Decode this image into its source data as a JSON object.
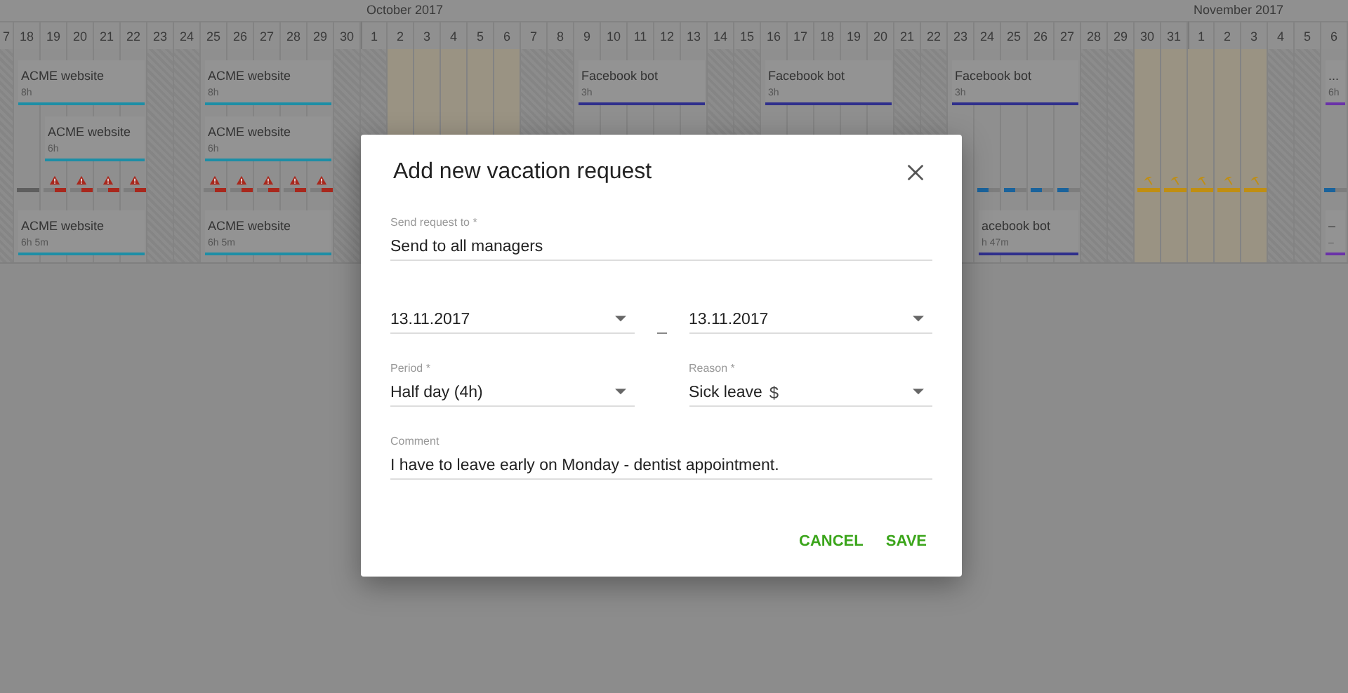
{
  "calendar": {
    "days": [
      {
        "label": "7",
        "kind": "weekend"
      },
      {
        "label": "18",
        "kind": "weekday",
        "marker": {
          "kind": "idle"
        },
        "tasks": [
          {
            "kind": "top",
            "title": "ACME website",
            "hours": "8h",
            "color": "#1d8ea6"
          },
          {
            "kind": "bottom",
            "title": "ACME website",
            "hours": "6h 5m",
            "color": "#1d8ea6"
          }
        ]
      },
      {
        "label": "19",
        "kind": "weekday",
        "marker": {
          "kind": "warning"
        },
        "tasks": [
          {
            "kind": "middle",
            "title": "ACME website",
            "hours": "6h",
            "color": "#1d8ea6"
          }
        ]
      },
      {
        "label": "20",
        "kind": "weekday",
        "marker": {
          "kind": "warning"
        }
      },
      {
        "label": "21",
        "kind": "weekday",
        "marker": {
          "kind": "warning"
        }
      },
      {
        "label": "22",
        "kind": "weekday",
        "marker": {
          "kind": "warning"
        }
      },
      {
        "label": "23",
        "kind": "weekend"
      },
      {
        "label": "24",
        "kind": "weekend"
      },
      {
        "label": "25",
        "kind": "weekday",
        "marker": {
          "kind": "warning"
        },
        "tasks": [
          {
            "kind": "top",
            "title": "ACME website",
            "hours": "8h",
            "color": "#1d8ea6"
          },
          {
            "kind": "middle",
            "title": "ACME website",
            "hours": "6h",
            "color": "#1d8ea6"
          },
          {
            "kind": "bottom",
            "title": "ACME website",
            "hours": "6h 5m",
            "color": "#1d8ea6"
          }
        ]
      },
      {
        "label": "26",
        "kind": "weekday",
        "marker": {
          "kind": "warning"
        }
      },
      {
        "label": "27",
        "kind": "weekday",
        "marker": {
          "kind": "warning"
        }
      },
      {
        "label": "28",
        "kind": "weekday",
        "marker": {
          "kind": "warning"
        }
      },
      {
        "label": "29",
        "kind": "weekday",
        "marker": {
          "kind": "warning"
        }
      },
      {
        "label": "30",
        "kind": "weekend"
      },
      {
        "label": "1",
        "kind": "weekend",
        "month": "October 2017"
      },
      {
        "label": "2",
        "kind": "vacation"
      },
      {
        "label": "3",
        "kind": "vacation"
      },
      {
        "label": "4",
        "kind": "vacation"
      },
      {
        "label": "5",
        "kind": "vacation"
      },
      {
        "label": "6",
        "kind": "vacation"
      },
      {
        "label": "7",
        "kind": "weekend"
      },
      {
        "label": "8",
        "kind": "weekend"
      },
      {
        "label": "9",
        "kind": "weekday",
        "tasks": [
          {
            "kind": "top",
            "title": "Facebook bot",
            "hours": "3h",
            "color": "#2f2f8c"
          }
        ]
      },
      {
        "label": "10",
        "kind": "weekday"
      },
      {
        "label": "11",
        "kind": "weekday"
      },
      {
        "label": "12",
        "kind": "weekday"
      },
      {
        "label": "13",
        "kind": "weekday"
      },
      {
        "label": "14",
        "kind": "weekend"
      },
      {
        "label": "15",
        "kind": "weekend"
      },
      {
        "label": "16",
        "kind": "weekday",
        "tasks": [
          {
            "kind": "top",
            "title": "Facebook bot",
            "hours": "3h",
            "color": "#2f2f8c"
          }
        ]
      },
      {
        "label": "17",
        "kind": "weekday"
      },
      {
        "label": "18",
        "kind": "weekday"
      },
      {
        "label": "19",
        "kind": "weekday"
      },
      {
        "label": "20",
        "kind": "weekday"
      },
      {
        "label": "21",
        "kind": "weekend"
      },
      {
        "label": "22",
        "kind": "weekend"
      },
      {
        "label": "23",
        "kind": "weekday",
        "tasks": [
          {
            "kind": "top",
            "title": "Facebook bot",
            "hours": "3h",
            "color": "#2f2f8c"
          }
        ]
      },
      {
        "label": "24",
        "kind": "weekday",
        "marker": {
          "kind": "planned"
        },
        "tasks": [
          {
            "kind": "bottom",
            "title": "acebook bot",
            "hours": "h 47m",
            "color": "#2f2f8c"
          }
        ]
      },
      {
        "label": "25",
        "kind": "weekday",
        "marker": {
          "kind": "planned"
        }
      },
      {
        "label": "26",
        "kind": "weekday",
        "marker": {
          "kind": "planned"
        }
      },
      {
        "label": "27",
        "kind": "weekday",
        "marker": {
          "kind": "planned"
        }
      },
      {
        "label": "28",
        "kind": "weekend"
      },
      {
        "label": "29",
        "kind": "weekend"
      },
      {
        "label": "30",
        "kind": "vacation",
        "marker": {
          "kind": "vacation"
        }
      },
      {
        "label": "31",
        "kind": "vacation",
        "marker": {
          "kind": "vacation"
        }
      },
      {
        "label": "1",
        "kind": "vacation",
        "marker": {
          "kind": "vacation"
        },
        "month": "November 2017"
      },
      {
        "label": "2",
        "kind": "vacation",
        "marker": {
          "kind": "vacation"
        }
      },
      {
        "label": "3",
        "kind": "vacation",
        "marker": {
          "kind": "vacation"
        }
      },
      {
        "label": "4",
        "kind": "weekend"
      },
      {
        "label": "5",
        "kind": "weekend"
      },
      {
        "label": "6",
        "kind": "weekday",
        "marker": {
          "kind": "planned"
        },
        "tasks": [
          {
            "kind": "top",
            "title": "...",
            "hours": "6h",
            "color": "#6a32a8"
          },
          {
            "kind": "bottom",
            "title": "–",
            "hours": "–",
            "color": "#6a32a8"
          }
        ]
      }
    ]
  },
  "dialog": {
    "title": "Add new vacation request",
    "rows": [
      {
        "kind": "single",
        "fields": [
          {
            "kind": "text",
            "label": "Send request to *",
            "value": "Send to all managers"
          }
        ]
      },
      {
        "kind": "range",
        "fields": [
          {
            "kind": "select",
            "value": "13.11.2017"
          },
          {
            "kind": "select",
            "value": "13.11.2017"
          }
        ]
      },
      {
        "kind": "pair",
        "fields": [
          {
            "kind": "select",
            "label": "Period *",
            "value": "Half day (4h)"
          },
          {
            "kind": "select",
            "label": "Reason *",
            "value": "Sick leave",
            "suffix": "$"
          }
        ]
      },
      {
        "kind": "single",
        "fields": [
          {
            "kind": "text",
            "label": "Comment",
            "value": "I have to leave early on Monday - dentist appointment."
          }
        ]
      }
    ],
    "buttons": [
      "CANCEL",
      "SAVE"
    ]
  }
}
